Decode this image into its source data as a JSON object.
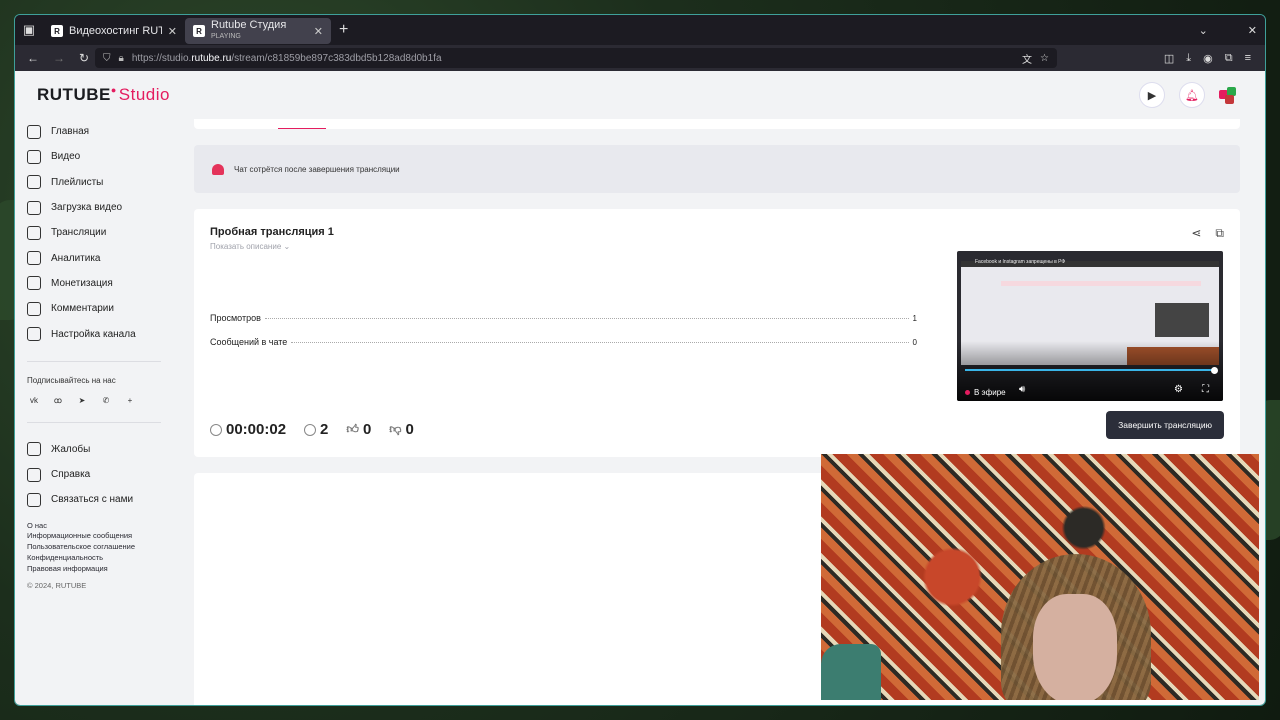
{
  "browser": {
    "tabs": [
      {
        "favicon": "R",
        "title": "Видеохостинг RUTUBE",
        "subtitle": ""
      },
      {
        "favicon": "R",
        "title": "Rutube Студия",
        "subtitle": "PLAYING"
      }
    ],
    "url_prefix": "https://studio.",
    "url_domain": "rutube.ru",
    "url_path": "/stream/c81859be897c383dbd5b128ad8d0b1fa"
  },
  "app": {
    "logo_main": "RUTUBE",
    "logo_sub": "Studio"
  },
  "sidebar": {
    "items": [
      {
        "label": "Главная",
        "icon": "home-icon"
      },
      {
        "label": "Видео",
        "icon": "video-icon"
      },
      {
        "label": "Плейлисты",
        "icon": "playlist-icon"
      },
      {
        "label": "Загрузка видео",
        "icon": "upload-icon"
      },
      {
        "label": "Трансляции",
        "icon": "broadcast-icon"
      },
      {
        "label": "Аналитика",
        "icon": "analytics-icon"
      },
      {
        "label": "Монетизация",
        "icon": "monetization-icon"
      },
      {
        "label": "Комментарии",
        "icon": "comments-icon"
      },
      {
        "label": "Настройка канала",
        "icon": "settings-icon"
      }
    ],
    "subscribe_title": "Подписывайтесь на нас",
    "socials": [
      "vk",
      "ok",
      "telegram",
      "viber",
      "more"
    ],
    "support": [
      {
        "label": "Жалобы",
        "icon": "flag-icon"
      },
      {
        "label": "Справка",
        "icon": "help-icon"
      },
      {
        "label": "Связаться с нами",
        "icon": "contact-icon"
      }
    ],
    "links": [
      "О нас",
      "Информационные сообщения",
      "Пользовательское соглашение",
      "Конфиденциальность",
      "Правовая информация"
    ],
    "copyright": "© 2024, RUTUBE"
  },
  "alert": {
    "text": "Чат сотрётся после завершения трансляции"
  },
  "stream": {
    "title": "Пробная трансляция 1",
    "show_description": "Показать описание",
    "stats": [
      {
        "label": "Просмотров",
        "value": "1"
      },
      {
        "label": "Сообщений в чате",
        "value": "0"
      }
    ],
    "duration": "00:00:02",
    "viewers": "2",
    "likes": "0",
    "dislikes": "0",
    "end_button": "Завершить трансляцию",
    "player_live": "В эфире",
    "player_title": "Facebook и Instagram запрещены в РФ"
  },
  "colors": {
    "accent": "#e41c5f",
    "end_button_bg": "#2b2e3a",
    "progress": "#3ab5e8"
  }
}
